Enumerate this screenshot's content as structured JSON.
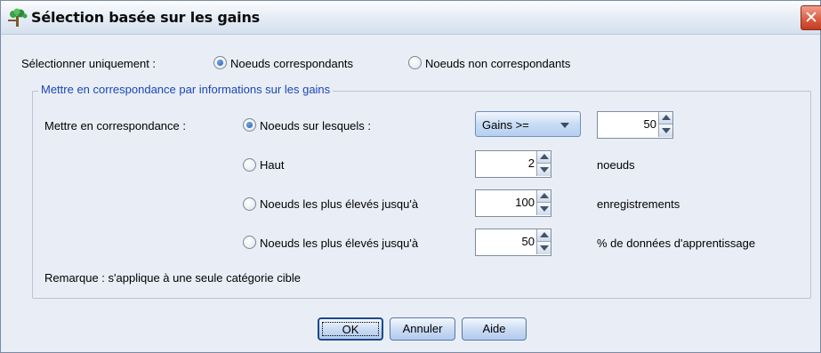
{
  "dialog": {
    "title": "Sélection basée sur les gains",
    "close_symbol": "✕"
  },
  "select_only": {
    "label": "Sélectionner uniquement :",
    "options": [
      {
        "label": "Noeuds correspondants",
        "checked": true
      },
      {
        "label": "Noeuds non correspondants",
        "checked": false
      }
    ]
  },
  "group": {
    "legend": "Mettre en correspondance par informations sur les gains",
    "match_label": "Mettre en correspondance :",
    "rows": [
      {
        "label": "Noeuds sur lesquels :",
        "checked": true,
        "combo": "Gains >=",
        "value": "50",
        "unit": ""
      },
      {
        "label": "Haut",
        "checked": false,
        "value": "2",
        "unit": "noeuds"
      },
      {
        "label": "Noeuds les plus élevés jusqu'à",
        "checked": false,
        "value": "100",
        "unit": "enregistrements"
      },
      {
        "label": "Noeuds les plus élevés jusqu'à",
        "checked": false,
        "value": "50",
        "unit": "% de données d'apprentissage"
      }
    ],
    "note": "Remarque : s'applique à une seule catégorie cible"
  },
  "buttons": {
    "ok": "OK",
    "cancel": "Annuler",
    "help": "Aide"
  },
  "icons": {
    "title": "tree-icon",
    "close": "close-icon"
  }
}
